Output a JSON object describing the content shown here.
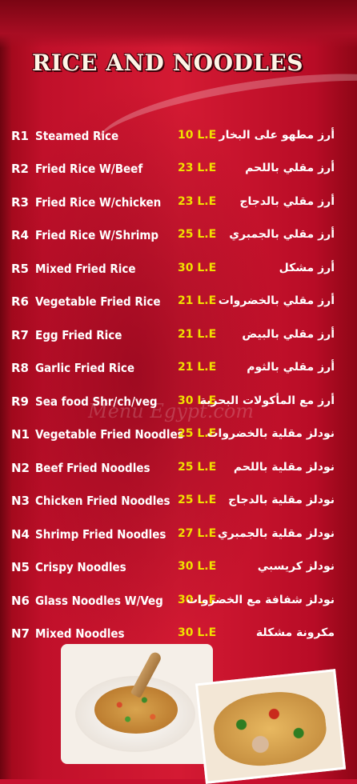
{
  "title": "RICE AND NOODLES",
  "watermark": "Menu Egypt.com",
  "items": [
    {
      "code": "R1",
      "name": "Steamed Rice",
      "price": "10 L.E",
      "arabic": "أرز مطهو على البخار"
    },
    {
      "code": "R2",
      "name": "Fried Rice W/Beef",
      "price": "23 L.E",
      "arabic": "أرز مقلي باللحم"
    },
    {
      "code": "R3",
      "name": "Fried Rice W/chicken",
      "price": "23 L.E",
      "arabic": "أرز مقلي بالدجاج"
    },
    {
      "code": "R4",
      "name": "Fried Rice W/Shrimp",
      "price": "25 L.E",
      "arabic": "أرز مقلي بالجمبري"
    },
    {
      "code": "R5",
      "name": "Mixed Fried Rice",
      "price": "30 L.E",
      "arabic": "أرز مشكل"
    },
    {
      "code": "R6",
      "name": "Vegetable Fried Rice",
      "price": "21 L.E",
      "arabic": "أرز مقلي بالخضروات"
    },
    {
      "code": "R7",
      "name": "Egg Fried Rice",
      "price": "21 L.E",
      "arabic": "أرز مقلي بالبيض"
    },
    {
      "code": "R8",
      "name": "Garlic Fried Rice",
      "price": "21 L.E",
      "arabic": "أرز مقلي بالثوم"
    },
    {
      "code": "R9",
      "name": "Sea food Shr/ch/veg",
      "price": "30 L.E",
      "arabic": "أرز مع المأكولات البحرية"
    },
    {
      "code": "N1",
      "name": "Vegetable Fried Noodles",
      "price": "25 L.E",
      "arabic": "نودلز مقلية بالخضروات"
    },
    {
      "code": "N2",
      "name": "Beef Fried Noodles",
      "price": "25 L.E",
      "arabic": "نودلز مقلية باللحم"
    },
    {
      "code": "N3",
      "name": "Chicken Fried Noodles",
      "price": "25 L.E",
      "arabic": "نودلز مقلية بالدجاج"
    },
    {
      "code": "N4",
      "name": "Shrimp Fried Noodles",
      "price": "27 L.E",
      "arabic": "نودلز مقلية بالجمبري"
    },
    {
      "code": "N5",
      "name": "Crispy Noodles",
      "price": "30 L.E",
      "arabic": "نودلز كريسبي"
    },
    {
      "code": "N6",
      "name": "Glass Noodles W/Veg",
      "price": "30 L.E",
      "arabic": "نودلز شفافة مع الخضروات"
    },
    {
      "code": "N7",
      "name": "Mixed Noodles",
      "price": "30 L.E",
      "arabic": "مكرونة مشكلة"
    }
  ]
}
